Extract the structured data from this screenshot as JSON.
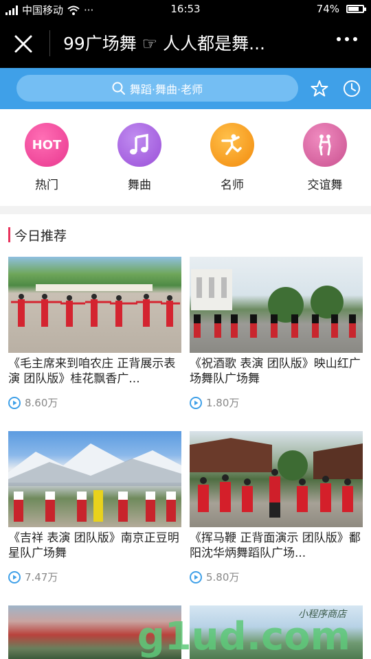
{
  "status_bar": {
    "carrier": "中国移动",
    "time": "16:53",
    "battery": "74%",
    "battery_level": 0.74,
    "more": "···"
  },
  "header": {
    "title": "99广场舞 ☞ 人人都是舞..."
  },
  "search": {
    "placeholder": "舞蹈·舞曲·老师"
  },
  "categories": [
    {
      "label": "热门",
      "icon": "hot-icon",
      "icon_text": "HOT",
      "color": "#e8368e"
    },
    {
      "label": "舞曲",
      "icon": "music-note-icon",
      "color": "#9a4fd8"
    },
    {
      "label": "名师",
      "icon": "dancer-icon",
      "color": "#f39c12"
    },
    {
      "label": "交谊舞",
      "icon": "couple-dance-icon",
      "color": "#d65c9e"
    }
  ],
  "section": {
    "title": "今日推荐"
  },
  "videos": [
    {
      "title": "《毛主席来到咱农庄 正背展示表演 团队版》桂花飘香广...",
      "plays": "8.60万"
    },
    {
      "title": "《祝酒歌 表演 团队版》映山红广场舞队广场舞",
      "plays": "1.80万"
    },
    {
      "title": "《吉祥 表演 团队版》南京正豆明星队广场舞",
      "plays": "7.47万"
    },
    {
      "title": "《挥马鞭 正背面演示 团队版》鄱阳沈华炳舞蹈队广场...",
      "plays": "5.80万"
    }
  ],
  "watermark": {
    "text": "g1ud.com",
    "subtext": "小程序商店"
  },
  "colors": {
    "accent": "#3fa0e8",
    "section_bar": "#e8325b"
  }
}
